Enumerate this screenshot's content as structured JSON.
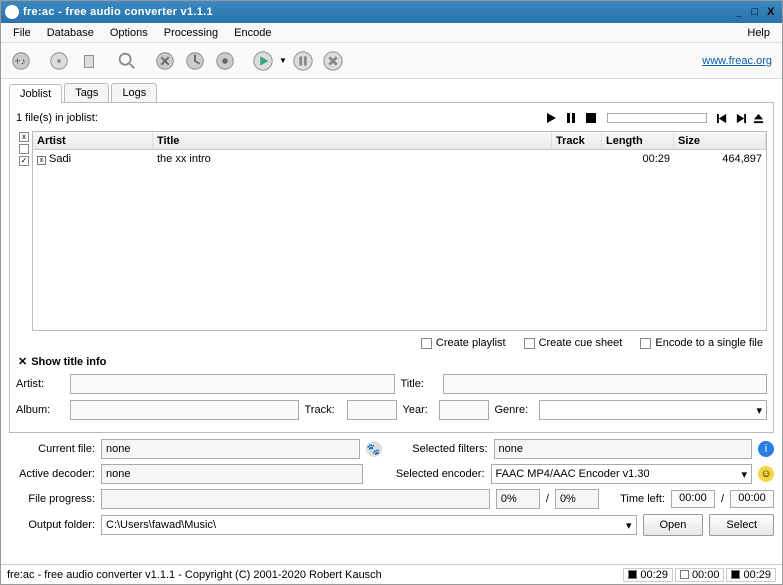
{
  "window": {
    "title": "fre:ac - free audio converter v1.1.1"
  },
  "menu": {
    "items": [
      "File",
      "Database",
      "Options",
      "Processing",
      "Encode"
    ],
    "help": "Help"
  },
  "toolbar": {
    "link": "www.freac.org"
  },
  "tabs": {
    "joblist": "Joblist",
    "tags": "Tags",
    "logs": "Logs"
  },
  "joblist": {
    "count_label": "1 file(s) in joblist:",
    "columns": {
      "artist": "Artist",
      "title": "Title",
      "track": "Track",
      "length": "Length",
      "size": "Size"
    },
    "rows": [
      {
        "artist": "Sadi",
        "title": "the xx intro",
        "track": "",
        "length": "00:29",
        "size": "464,897"
      }
    ]
  },
  "options": {
    "create_playlist": "Create playlist",
    "create_cuesheet": "Create cue sheet",
    "encode_single": "Encode to a single file"
  },
  "titleinfo": {
    "toggle": "Show title info"
  },
  "meta": {
    "artist_label": "Artist:",
    "title_label": "Title:",
    "album_label": "Album:",
    "track_label": "Track:",
    "year_label": "Year:",
    "genre_label": "Genre:"
  },
  "panel": {
    "current_file_label": "Current file:",
    "current_file": "none",
    "selected_filters_label": "Selected filters:",
    "selected_filters": "none",
    "active_decoder_label": "Active decoder:",
    "active_decoder": "none",
    "selected_encoder_label": "Selected encoder:",
    "selected_encoder": "FAAC MP4/AAC Encoder v1.30",
    "file_progress_label": "File progress:",
    "progress_a": "0%",
    "slash": "/",
    "progress_b": "0%",
    "time_left_label": "Time left:",
    "time_a": "00:00",
    "time_b": "00:00",
    "output_folder_label": "Output folder:",
    "output_folder": "C:\\Users\\fawad\\Music\\",
    "open": "Open",
    "select": "Select"
  },
  "status": {
    "text": "fre:ac - free audio converter v1.1.1 - Copyright (C) 2001-2020 Robert Kausch",
    "t1": "00:29",
    "t2": "00:00",
    "t3": "00:29"
  }
}
